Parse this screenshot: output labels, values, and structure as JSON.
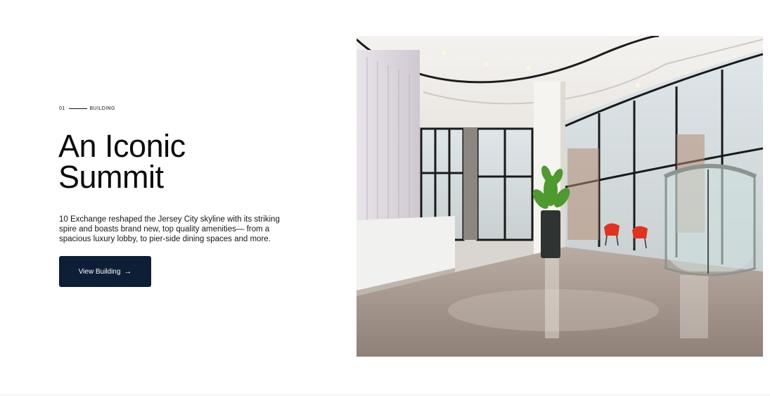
{
  "section": {
    "number": "01",
    "label": "BUILDING"
  },
  "headline": {
    "line1": "An Iconic",
    "line2": "Summit"
  },
  "description": "10 Exchange reshaped the Jersey City skyline with its striking spire and boasts brand new, top quality amenities— from a spacious luxury lobby, to pier-side dining spaces and more.",
  "cta": {
    "label": "View Building",
    "icon": "arrow-right-icon",
    "arrow_glyph": "→",
    "background": "#0c1f36",
    "text_color": "#ffffff"
  },
  "image": {
    "subject": "lobby-photo"
  }
}
